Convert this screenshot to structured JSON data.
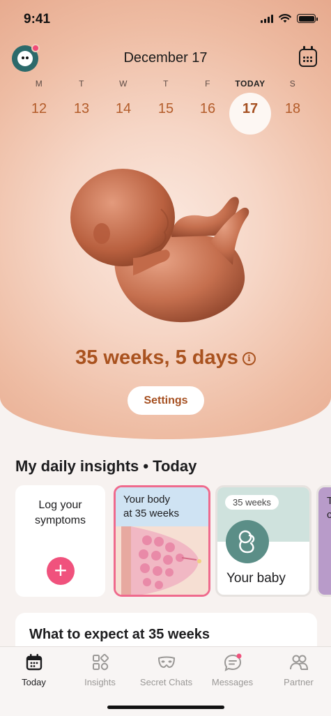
{
  "status": {
    "time": "9:41"
  },
  "header": {
    "date": "December 17"
  },
  "week": {
    "days": [
      {
        "name": "M",
        "num": "12"
      },
      {
        "name": "T",
        "num": "13"
      },
      {
        "name": "W",
        "num": "14"
      },
      {
        "name": "T",
        "num": "15"
      },
      {
        "name": "F",
        "num": "16"
      },
      {
        "name": "TODAY",
        "num": "17"
      },
      {
        "name": "S",
        "num": "18"
      }
    ]
  },
  "pregnancy": {
    "progress": "35 weeks, 5 days",
    "info_symbol": "i"
  },
  "settings_label": "Settings",
  "insights": {
    "title": "My daily insights • Today",
    "log_card": {
      "line1": "Log your",
      "line2": "symptoms",
      "plus": "+"
    },
    "body_card": {
      "line1": "Your body",
      "line2": "at 35 weeks"
    },
    "baby_card": {
      "pill": "35 weeks",
      "label": "Your baby"
    },
    "next_card": {
      "line1": "T",
      "line2": "c"
    }
  },
  "expect": {
    "title": "What to expect at 35 weeks"
  },
  "tabs": [
    {
      "label": "Today",
      "icon": "calendar-icon"
    },
    {
      "label": "Insights",
      "icon": "insights-grid-icon"
    },
    {
      "label": "Secret Chats",
      "icon": "mask-icon"
    },
    {
      "label": "Messages",
      "icon": "chat-bubble-icon"
    },
    {
      "label": "Partner",
      "icon": "partner-icon"
    }
  ],
  "colors": {
    "accent": "#a9521f",
    "pink": "#f0527d",
    "teal": "#5b8e87"
  }
}
